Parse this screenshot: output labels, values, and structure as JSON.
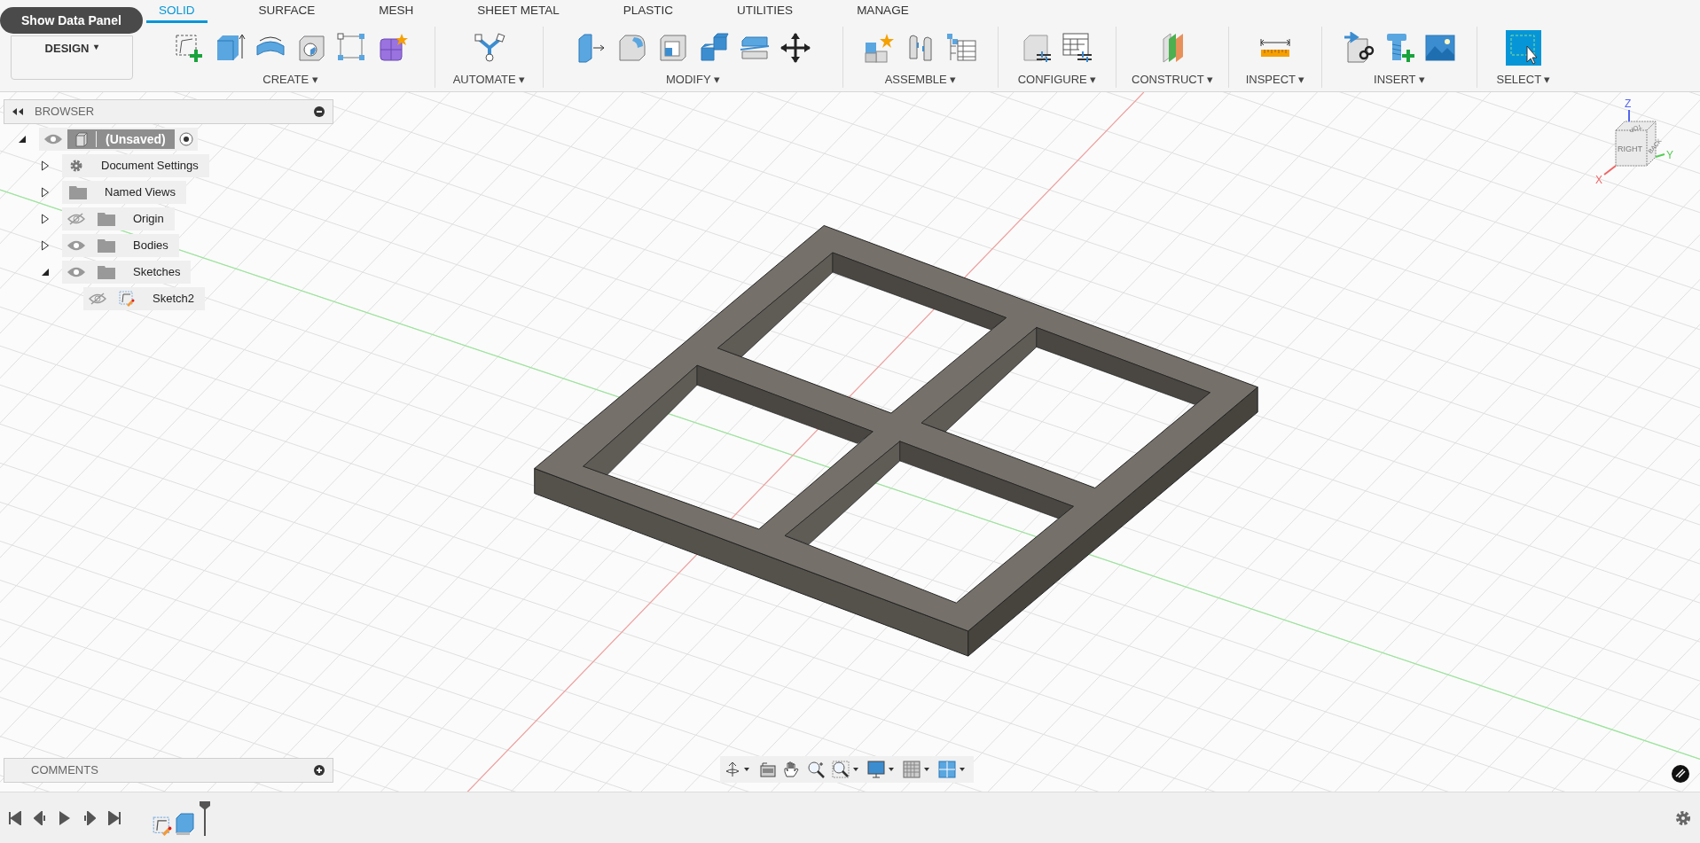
{
  "data_panel_button": "Show Data Panel",
  "workspace": {
    "label": "DESIGN",
    "caret": "▾"
  },
  "tabs": [
    {
      "label": "SOLID",
      "selected": true
    },
    {
      "label": "SURFACE",
      "selected": false
    },
    {
      "label": "MESH",
      "selected": false
    },
    {
      "label": "SHEET METAL",
      "selected": false
    },
    {
      "label": "PLASTIC",
      "selected": false
    },
    {
      "label": "UTILITIES",
      "selected": false
    },
    {
      "label": "MANAGE",
      "selected": false
    }
  ],
  "groups": [
    {
      "kind": "create",
      "label": "CREATE ▾"
    },
    {
      "kind": "automate",
      "label": "AUTOMATE ▾"
    },
    {
      "kind": "modify",
      "label": "MODIFY ▾"
    },
    {
      "kind": "assemble",
      "label": "ASSEMBLE ▾"
    },
    {
      "kind": "configure",
      "label": "CONFIGURE ▾"
    },
    {
      "kind": "construct",
      "label": "CONSTRUCT ▾"
    },
    {
      "kind": "inspect",
      "label": "INSPECT ▾"
    },
    {
      "kind": "insert",
      "label": "INSERT ▾"
    },
    {
      "kind": "select",
      "label": "SELECT ▾"
    }
  ],
  "browser": {
    "title": "BROWSER",
    "tree": [
      {
        "label": "(Unsaved)",
        "kind": "root",
        "expanded": true,
        "visible": true,
        "children": [
          {
            "label": "Document Settings",
            "kind": "settings",
            "expanded": false
          },
          {
            "label": "Named Views",
            "kind": "folder",
            "expanded": false
          },
          {
            "label": "Origin",
            "kind": "folder",
            "expanded": false,
            "visible": false
          },
          {
            "label": "Bodies",
            "kind": "folder",
            "expanded": false,
            "visible": true
          },
          {
            "label": "Sketches",
            "kind": "folder",
            "expanded": true,
            "visible": true,
            "children": [
              {
                "label": "Sketch2",
                "kind": "sketch",
                "visible": false
              }
            ]
          }
        ]
      }
    ]
  },
  "comments": {
    "title": "COMMENTS"
  },
  "viewcube": {
    "faces": [
      "RIGHT",
      "BACK",
      "TOP"
    ],
    "axes": [
      "Z",
      "X",
      "Y"
    ]
  }
}
